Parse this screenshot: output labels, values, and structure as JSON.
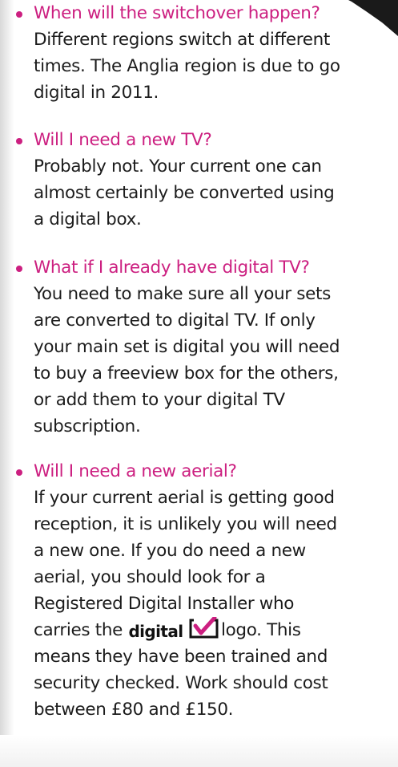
{
  "faq": [
    {
      "question": "When will the switchover happen?",
      "answer_lines": [
        "Different regions switch at different",
        "times. The Anglia region is due to go",
        "digital in 2011."
      ]
    },
    {
      "question": "Will I need a new TV?",
      "answer_lines": [
        "Probably not. Your current one can",
        "almost certainly be converted using",
        "a digital box."
      ]
    },
    {
      "question": "What if I already have digital TV?",
      "answer_lines": [
        "You need to make sure all your sets",
        "are converted to digital TV. If only",
        "your main set is digital you will need",
        "to buy a freeview box for the others,",
        "or add them to your digital TV",
        "subscription."
      ]
    },
    {
      "question": "Will I need a new aerial?",
      "answer_lines": [
        "If your current aerial is getting good",
        "reception, it is unlikely you will need",
        "a new one. If you do need a new",
        "aerial, you should look for a",
        "Registered Digital Installer who"
      ],
      "logo_line_before": "carries the",
      "logo_word": "digital",
      "logo_line_after": "logo. This",
      "answer_lines_after": [
        "means they have been trained and",
        "security checked. Work should cost",
        "between £80 and £150."
      ]
    }
  ],
  "colors": {
    "question": "#cc1f80",
    "body_text": "#1c1c1c",
    "bullet": "#cc1f80",
    "logo_tick": "#cc1f80"
  },
  "icons": {
    "bullet": "bullet-dot-icon",
    "logo": "digital-tick-logo-icon"
  }
}
